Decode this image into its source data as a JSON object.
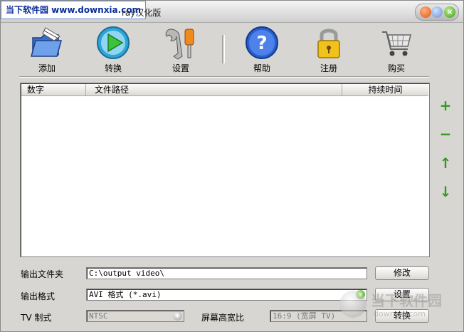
{
  "window": {
    "title": "ray汉化版",
    "watermark_logo": "当下软件园 www.downxia.com",
    "watermark_corner": "当下软件园",
    "watermark_corner_sub": "downxia.com"
  },
  "toolbar": {
    "add": "添加",
    "convert": "转换",
    "settings": "设置",
    "help": "帮助",
    "register": "注册",
    "buy": "购买"
  },
  "list": {
    "columns": [
      "数字",
      "文件路径",
      "持续时间"
    ]
  },
  "side_buttons": {
    "add": "+",
    "remove": "−",
    "up": "↑",
    "down": "↓"
  },
  "form": {
    "output_folder_label": "输出文件夹",
    "output_folder_value": "C:\\output video\\",
    "change_button": "修改",
    "output_format_label": "输出格式",
    "output_format_value": "AVI 格式 (*.avi)",
    "settings_button": "设置",
    "tv_label": "TV 制式",
    "tv_value": "NTSC",
    "aspect_label": "屏幕高宽比",
    "aspect_value": "16:9   (宽屏 TV)",
    "convert_button": "转换"
  },
  "colors": {
    "accent_green": "#2f9a1c",
    "window_bg": "#d8d6d2"
  }
}
